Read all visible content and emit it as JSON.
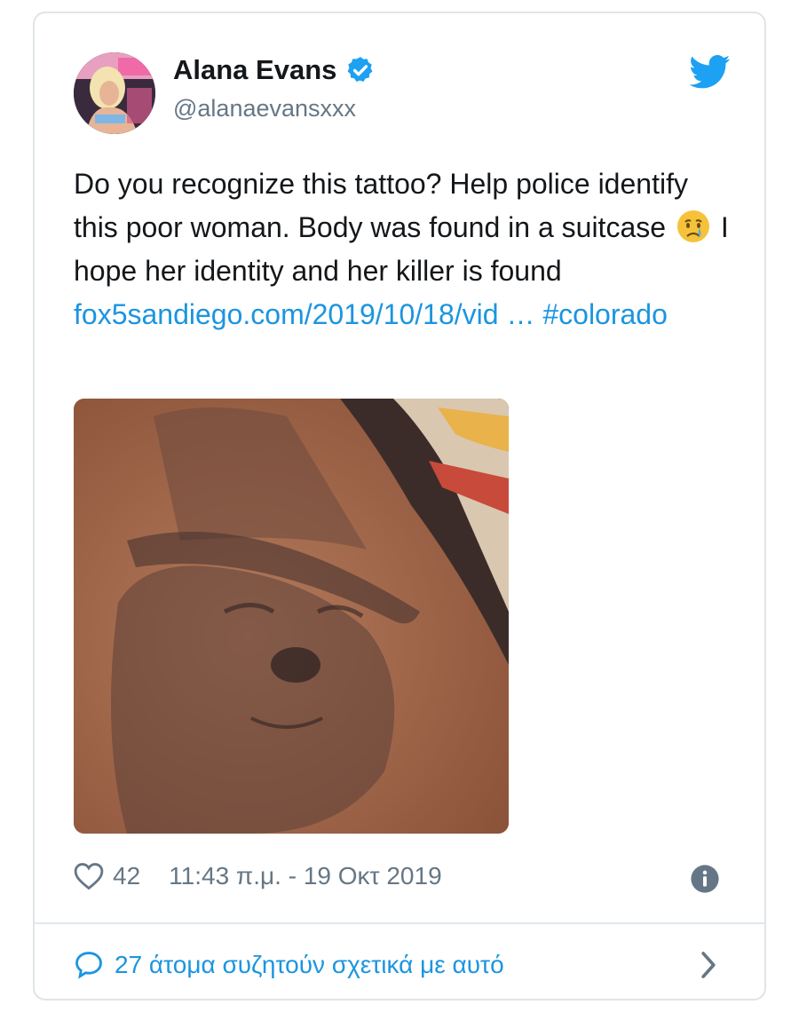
{
  "tweet": {
    "author_name": "Alana Evans",
    "author_handle": "@alanaevansxxx",
    "text_part1": "Do you recognize this tattoo? Help police identify this poor woman. Body was found in a suitcase",
    "emoji_icon": "crying-face-icon",
    "text_part2": "I hope her identity and her killer is found",
    "link_text": "fox5sandiego.com/2019/10/18/vid …",
    "hashtag": "#colorado",
    "likes": "42",
    "timestamp": "11:43 π.μ. - 19 Οκτ 2019",
    "discussion": "27 άτομα συζητούν σχετικά με αυτό"
  },
  "colors": {
    "link": "#1b95e0",
    "secondary_text": "#657786",
    "verified_badge": "#1da1f2",
    "twitter_bird": "#1da1f2"
  },
  "icons": {
    "verified": "verified-badge-icon",
    "brand": "twitter-bird-icon",
    "like": "heart-icon",
    "info": "info-icon",
    "reply": "speech-bubble-icon",
    "more": "chevron-right-icon"
  }
}
